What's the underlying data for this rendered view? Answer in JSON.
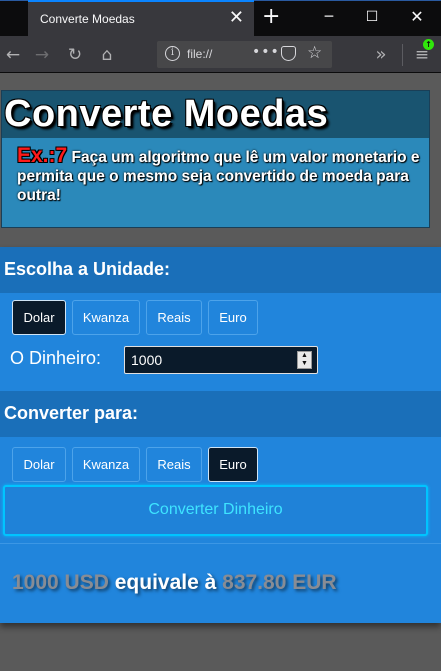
{
  "browser": {
    "tab_title": "Converte Moedas",
    "url": "file://",
    "url_dots": "•••"
  },
  "header": {
    "title": "Converte Moedas",
    "exercise_tag": "Ex.:7",
    "description": "Faça um algoritmo que lê um valor monetario e permita que o mesmo seja convertido de moeda para outra!"
  },
  "unit_section": {
    "heading": "Escolha a Unidade:",
    "buttons": [
      "Dolar",
      "Kwanza",
      "Reais",
      "Euro"
    ],
    "selected": "Dolar",
    "money_label": "O Dinheiro:",
    "money_value": "1000"
  },
  "target_section": {
    "heading": "Converter para:",
    "buttons": [
      "Dolar",
      "Kwanza",
      "Reais",
      "Euro"
    ],
    "selected": "Euro"
  },
  "convert_button": "Converter Dinheiro",
  "result": {
    "amount": "1000 USD",
    "connector": "equivale à",
    "converted": "837.80 EUR"
  },
  "colors": {
    "panel_bg": "#2185dc",
    "section_head_bg": "#1a6fb9",
    "header_title_bg": "#195470",
    "header_desc_bg": "#2b89ba",
    "exercise_tag": "#ff1a1a",
    "convert_text": "#3ee4ff",
    "result_value": "#888c94"
  },
  "icons": [
    "back-arrow-icon",
    "forward-arrow-icon",
    "reload-icon",
    "home-icon",
    "info-icon",
    "pocket-icon",
    "bookmark-star-icon",
    "overflow-chevrons-icon",
    "hamburger-menu-icon",
    "close-icon",
    "plus-icon",
    "minimize-icon",
    "maximize-icon"
  ]
}
